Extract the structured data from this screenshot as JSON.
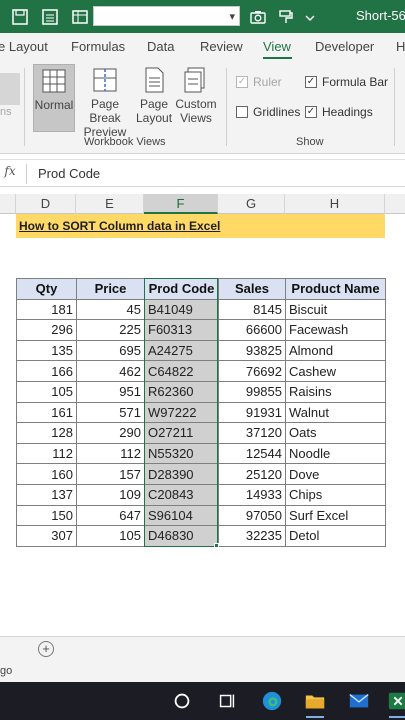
{
  "titlebar": {
    "title": "Short-56_"
  },
  "ribbon": {
    "tabs": [
      "e Layout",
      "Formulas",
      "Data",
      "Review",
      "View",
      "Developer",
      "H"
    ],
    "active_tab": "View",
    "workbook_views": {
      "buttons": [
        {
          "label": "Normal",
          "selected": true
        },
        {
          "label": "Page Break Preview",
          "selected": false
        },
        {
          "label": "Page Layout",
          "selected": false
        },
        {
          "label": "Custom Views",
          "selected": false
        }
      ],
      "group_label": "Workbook Views"
    },
    "show": {
      "ruler": {
        "label": "Ruler",
        "checked": true,
        "disabled": true
      },
      "formula_bar": {
        "label": "Formula Bar",
        "checked": true
      },
      "gridlines": {
        "label": "Gridlines",
        "checked": false
      },
      "headings": {
        "label": "Headings",
        "checked": true
      },
      "group_label": "Show"
    },
    "left_partial": "ns"
  },
  "formula_bar": {
    "fx": "fx",
    "value": "Prod Code"
  },
  "columns": [
    "D",
    "E",
    "F",
    "G",
    "H"
  ],
  "selected_column": "F",
  "sheet": {
    "banner": "How to SORT Column data in Excel",
    "headers": [
      "Qty",
      "Price",
      "Prod Code",
      "Sales",
      "Product Name"
    ],
    "rows": [
      [
        "181",
        "45",
        "B41049",
        "8145",
        "Biscuit"
      ],
      [
        "296",
        "225",
        "F60313",
        "66600",
        "Facewash"
      ],
      [
        "135",
        "695",
        "A24275",
        "93825",
        "Almond"
      ],
      [
        "166",
        "462",
        "C64822",
        "76692",
        "Cashew"
      ],
      [
        "105",
        "951",
        "R62360",
        "99855",
        "Raisins"
      ],
      [
        "161",
        "571",
        "W97222",
        "91931",
        "Walnut"
      ],
      [
        "128",
        "290",
        "O27211",
        "37120",
        "Oats"
      ],
      [
        "112",
        "112",
        "N55320",
        "12544",
        "Noodle"
      ],
      [
        "160",
        "157",
        "D28390",
        "25120",
        "Dove"
      ],
      [
        "137",
        "109",
        "C20843",
        "14933",
        "Chips"
      ],
      [
        "150",
        "647",
        "S96104",
        "97050",
        "Surf Excel"
      ],
      [
        "307",
        "105",
        "D46830",
        "32235",
        "Detol"
      ]
    ]
  },
  "sheet_bar": {
    "add_label": "+"
  },
  "status": {
    "text": "go"
  },
  "colors": {
    "excel_green": "#217346",
    "banner": "#ffd966",
    "header_fill": "#d9e1f2",
    "selection_fill": "#d0d0d0"
  },
  "taskbar": {
    "icons": [
      "cortana-icon",
      "task-view-icon",
      "edge-icon",
      "file-explorer-icon",
      "mail-icon",
      "excel-icon"
    ]
  }
}
